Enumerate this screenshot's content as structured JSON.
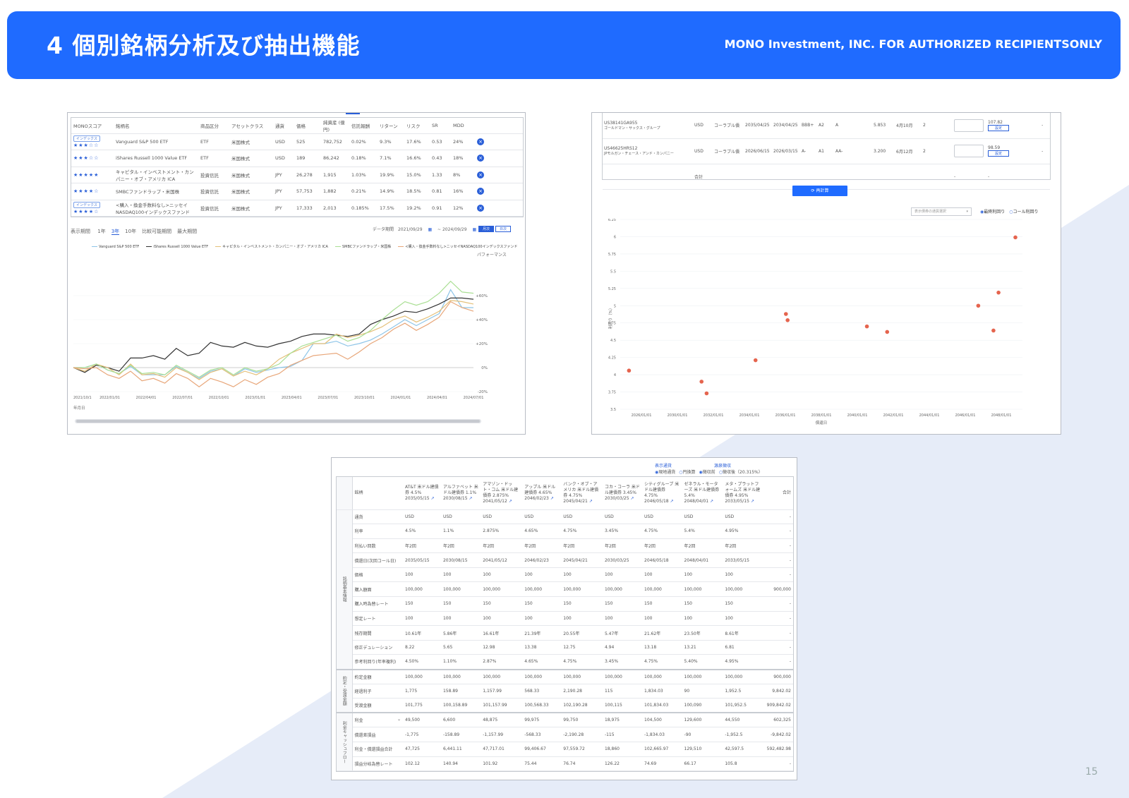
{
  "header": {
    "title": "4 個別銘柄分析及び抽出機能",
    "subtitle": "MONO Investment, INC. FOR AUTHORIZED RECIPIENTSONLY"
  },
  "page_number": "15",
  "colors": {
    "accent": "#1f6bff",
    "scatter_dot": "#e5644e",
    "background_shape": "#e6ecf8"
  },
  "fund_panel": {
    "columns": [
      "MONOスコア",
      "銘柄名",
      "商品区分",
      "アセットクラス",
      "通貨",
      "価格",
      "純資産\n(億円)",
      "信託報酬",
      "リターン",
      "リスク",
      "SR",
      "MDD"
    ],
    "rows": [
      {
        "badge": "インデックス",
        "stars": "★★★☆☆",
        "name": "Vanguard S&P 500 ETF",
        "type": "ETF",
        "asset": "米国株式",
        "currency": "USD",
        "price": "525",
        "aum": "782,752",
        "fee": "0.02%",
        "ret": "9.3%",
        "risk": "17.6%",
        "sr": "0.53",
        "mdd": "24%"
      },
      {
        "badge": "",
        "stars": "★★★☆☆",
        "name": "iShares Russell 1000 Value ETF",
        "type": "ETF",
        "asset": "米国株式",
        "currency": "USD",
        "price": "189",
        "aum": "86,242",
        "fee": "0.18%",
        "ret": "7.1%",
        "risk": "16.6%",
        "sr": "0.43",
        "mdd": "18%"
      },
      {
        "badge": "",
        "stars": "★★★★★",
        "name": "キャピタル・インベストメント・カンパニー・オブ・アメリカ ICA",
        "type": "投資信託",
        "asset": "米国株式",
        "currency": "JPY",
        "price": "26,278",
        "aum": "1,915",
        "fee": "1.03%",
        "ret": "19.9%",
        "risk": "15.0%",
        "sr": "1.33",
        "mdd": "8%"
      },
      {
        "badge": "",
        "stars": "★★★★☆",
        "name": "SMBCファンドラップ・米国株",
        "type": "投資信託",
        "asset": "米国株式",
        "currency": "JPY",
        "price": "57,753",
        "aum": "1,882",
        "fee": "0.21%",
        "ret": "14.9%",
        "risk": "18.5%",
        "sr": "0.81",
        "mdd": "16%"
      },
      {
        "badge": "インデックス",
        "stars": "★★★★☆",
        "name": "<購入・換金手数料なし>ニッセイNASDAQ100インデックスファンド",
        "type": "投資信託",
        "asset": "米国株式",
        "currency": "JPY",
        "price": "17,333",
        "aum": "2,013",
        "fee": "0.185%",
        "ret": "17.5%",
        "risk": "19.2%",
        "sr": "0.91",
        "mdd": "12%"
      }
    ],
    "period_label": "表示期間",
    "period_tabs": [
      "1年",
      "3年",
      "10年",
      "比較可能期間",
      "最大期間"
    ],
    "period_active": 1,
    "date_label": "データ期間",
    "date_from": "2021/09/29",
    "date_to": "~ 2024/09/29",
    "view_buttons": [
      "月次",
      "日次"
    ],
    "perf_label": "パフォーマンス",
    "date_axis_label": "年月日"
  },
  "perf_chart": {
    "type": "line",
    "x": [
      "2021/10/01",
      "2021/11/01",
      "2021/12/01",
      "2022/01/01",
      "2022/02/01",
      "2022/03/01",
      "2022/04/01",
      "2022/05/01",
      "2022/06/01",
      "2022/07/01",
      "2022/08/01",
      "2022/09/01",
      "2022/10/01",
      "2022/11/01",
      "2022/12/01",
      "2023/01/01",
      "2023/02/01",
      "2023/03/01",
      "2023/04/01",
      "2023/05/01",
      "2023/06/01",
      "2023/07/01",
      "2023/08/01",
      "2023/09/01",
      "2023/10/01",
      "2023/11/01",
      "2023/12/01",
      "2024/01/01",
      "2024/02/01",
      "2024/03/01",
      "2024/04/01",
      "2024/05/01",
      "2024/06/01",
      "2024/07/01",
      "2024/08/01",
      "2024/09/01"
    ],
    "x_ticks": [
      "2021/10/1",
      "2022/01/01",
      "2022/04/01",
      "2022/07/01",
      "2022/10/01",
      "2023/01/01",
      "2023/04/01",
      "2023/07/01",
      "2023/10/01",
      "2024/01/01",
      "2024/04/01",
      "2024/07/01"
    ],
    "y_ticks": [
      "+60%",
      "+40%",
      "+20%",
      "0%",
      "-20%"
    ],
    "ylim": [
      -20,
      80
    ],
    "series": [
      {
        "name": "Vanguard S&P 500 ETF",
        "color": "#8ec5e8",
        "values": [
          0,
          0,
          3,
          -2,
          -5,
          1,
          -6,
          -6,
          -6,
          1,
          -4,
          -9,
          -3,
          -1,
          -7,
          -1,
          -4,
          -2,
          0,
          1,
          6,
          20,
          20,
          22,
          18,
          20,
          23,
          28,
          34,
          40,
          35,
          40,
          45,
          65,
          50,
          50
        ]
      },
      {
        "name": "iShares Russell 1000 Value ETF",
        "color": "#333333",
        "values": [
          0,
          -4,
          2,
          0,
          -3,
          8,
          8,
          10,
          7,
          16,
          10,
          12,
          21,
          18,
          17,
          21,
          18,
          17,
          20,
          22,
          26,
          28,
          28,
          27,
          26,
          28,
          36,
          40,
          43,
          47,
          46,
          49,
          53,
          58,
          58,
          57
        ]
      },
      {
        "name": "キャピタル・インベストメント・カンパニー・オブ・アメリカ ICA",
        "color": "#e4c07a",
        "values": [
          0,
          -3,
          3,
          0,
          -6,
          3,
          -6,
          -5,
          -8,
          0,
          -4,
          -10,
          -4,
          -1,
          -7,
          -3,
          -6,
          -1,
          7,
          12,
          16,
          20,
          20,
          28,
          25,
          27,
          30,
          34,
          40,
          43,
          38,
          42,
          47,
          56,
          55,
          53
        ]
      },
      {
        "name": "SMBCファンドラップ・米国株",
        "color": "#aadf94",
        "values": [
          0,
          0,
          3,
          -2,
          -5,
          2,
          -5,
          -4,
          -6,
          2,
          -3,
          -8,
          -2,
          0,
          -6,
          0,
          -3,
          -1,
          3,
          12,
          18,
          21,
          24,
          27,
          22,
          25,
          31,
          40,
          48,
          55,
          52,
          55,
          62,
          72,
          63,
          62
        ]
      },
      {
        "name": "<購入・換金手数料なし>ニッセイNASDAQ100インデックスファンド",
        "color": "#e8a679",
        "values": [
          0,
          -1,
          0,
          -6,
          -9,
          -3,
          -11,
          -9,
          -13,
          -5,
          -9,
          -16,
          -9,
          -12,
          -16,
          -10,
          -14,
          -8,
          -5,
          2,
          6,
          10,
          11,
          12,
          7,
          13,
          20,
          25,
          32,
          37,
          31,
          36,
          42,
          55,
          50,
          47
        ]
      }
    ]
  },
  "bond_panel": {
    "rows": [
      {
        "code": "US38141GA955",
        "name": "ゴールドマン・サックス・グループ",
        "currency": "USD",
        "kind": "コーラブル債",
        "maturity": "2035/04/25",
        "call": "2034/04/25",
        "r1": "BBB+",
        "r2": "A2",
        "r3": "A",
        "yield": "5.853",
        "period": "4月10月",
        "count": "2",
        "price": "107.82",
        "btn": "設定"
      },
      {
        "code": "US46625HRS12",
        "name": "JPモルガン・チェース・アンド・カンパニー",
        "currency": "USD",
        "kind": "コーラブル債",
        "maturity": "2026/06/15",
        "call": "2026/03/15",
        "r1": "A-",
        "r2": "A1",
        "r3": "AA-",
        "yield": "3.200",
        "period": "6月12月",
        "count": "2",
        "price": "98.59",
        "btn": "設定"
      }
    ],
    "total_label": "合計",
    "total_dash_1": "-",
    "total_dash_2": "-",
    "recalc_button": "再計算",
    "select_placeholder": "表示債券の通貨選択",
    "radio_options": [
      "最終利回り",
      "コール利回り"
    ],
    "radio_selected": 0
  },
  "yield_chart": {
    "type": "scatter",
    "ylabel": "利回り（%）",
    "xlabel": "償還日",
    "y_ticks": [
      "6.25",
      "6",
      "5.75",
      "5.5",
      "5.25",
      "5",
      "4.75",
      "4.5",
      "4.25",
      "4",
      "3.75",
      "3.5"
    ],
    "ylim": [
      3.5,
      6.25
    ],
    "x_ticks": [
      "2026/01/01",
      "2030/01/01",
      "2032/01/01",
      "2034/01/01",
      "2036/01/01",
      "2038/01/01",
      "2040/01/01",
      "2042/01/01",
      "2044/01/01",
      "2046/01/01",
      "2048/01/01"
    ],
    "xlim": [
      2026.0,
      2049.0
    ],
    "points": [
      {
        "x": 2026.1,
        "y": 4.06
      },
      {
        "x": 2030.4,
        "y": 3.9
      },
      {
        "x": 2030.7,
        "y": 3.73
      },
      {
        "x": 2033.6,
        "y": 4.21
      },
      {
        "x": 2035.4,
        "y": 4.88
      },
      {
        "x": 2035.5,
        "y": 4.79
      },
      {
        "x": 2040.2,
        "y": 4.7
      },
      {
        "x": 2041.4,
        "y": 4.62
      },
      {
        "x": 2046.8,
        "y": 5.0
      },
      {
        "x": 2047.7,
        "y": 4.64
      },
      {
        "x": 2048.0,
        "y": 5.19
      },
      {
        "x": 2050.1,
        "y": 5.99
      }
    ]
  },
  "sim_panel": {
    "display_currency_label": "表示通貨",
    "currency_options": [
      "現地通貨",
      "円換算"
    ],
    "currency_selected": 0,
    "tax_label": "源泉徴収",
    "tax_options": [
      "徴収前",
      "徴収後（20.315%）"
    ],
    "tax_selected": 0,
    "corner_label": "銘柄",
    "total_header": "合計",
    "bonds": [
      "AT&T 米ドル建債券 4.5% 2035/05/15",
      "アルファベット 米ドル建債券 1.1% 2030/08/15",
      "アマゾン・ドット・コム 米ドル建債券 2.875% 2041/05/12",
      "アップル 米ドル建債券 4.65% 2046/02/23",
      "バンク・オブ・アメリカ 米ドル建債券 4.75% 2045/04/21",
      "コカ・コーラ 米ドル建債券 3.45% 2030/03/25",
      "シティグループ 米ドル建債券 4.75% 2046/05/18",
      "ゼネラル・モーターズ 米ドル建債券 5.4% 2048/04/01",
      "メタ・プラットフォームズ 米ドル建債券 4.95% 2033/05/15"
    ],
    "sections": [
      {
        "label": "銘柄基本情報",
        "rows": [
          {
            "label": "通貨",
            "values": [
              "USD",
              "USD",
              "USD",
              "USD",
              "USD",
              "USD",
              "USD",
              "USD",
              "USD"
            ],
            "total": "-"
          },
          {
            "label": "利率",
            "values": [
              "4.5%",
              "1.1%",
              "2.875%",
              "4.65%",
              "4.75%",
              "3.45%",
              "4.75%",
              "5.4%",
              "4.95%"
            ],
            "total": "-"
          },
          {
            "label": "利払い回数",
            "values": [
              "年2回",
              "年2回",
              "年2回",
              "年2回",
              "年2回",
              "年2回",
              "年2回",
              "年2回",
              "年2回"
            ],
            "total": "-"
          },
          {
            "label": "償還日(次回コール日)",
            "values": [
              "2035/05/15",
              "2030/08/15",
              "2041/05/12",
              "2046/02/23",
              "2045/04/21",
              "2030/03/25",
              "2046/05/18",
              "2048/04/01",
              "2033/05/15"
            ],
            "total": "-"
          },
          {
            "label": "価格",
            "values": [
              "100",
              "100",
              "100",
              "100",
              "100",
              "100",
              "100",
              "100",
              "100"
            ],
            "total": "-"
          },
          {
            "label": "購入額面",
            "values": [
              "100,000",
              "100,000",
              "100,000",
              "100,000",
              "100,000",
              "100,000",
              "100,000",
              "100,000",
              "100,000"
            ],
            "total": "900,000"
          },
          {
            "label": "購入時為替レート",
            "values": [
              "150",
              "150",
              "150",
              "150",
              "150",
              "150",
              "150",
              "150",
              "150"
            ],
            "total": "-"
          },
          {
            "label": "想定レート",
            "values": [
              "100",
              "100",
              "100",
              "100",
              "100",
              "100",
              "100",
              "100",
              "100"
            ],
            "total": "-"
          },
          {
            "label": "残存期間",
            "values": [
              "10.61年",
              "5.86年",
              "16.61年",
              "21.39年",
              "20.55年",
              "5.47年",
              "21.62年",
              "23.50年",
              "8.61年"
            ],
            "total": "-"
          },
          {
            "label": "修正デュレーション",
            "values": [
              "8.22",
              "5.65",
              "12.98",
              "13.38",
              "12.75",
              "4.94",
              "13.18",
              "13.21",
              "6.81"
            ],
            "total": "-"
          },
          {
            "label": "参考利回り(年率複利)",
            "values": [
              "4.50%",
              "1.10%",
              "2.87%",
              "4.65%",
              "4.75%",
              "3.45%",
              "4.75%",
              "5.40%",
              "4.95%"
            ],
            "total": "-"
          }
        ]
      },
      {
        "label": "約定・受渡金額",
        "rows": [
          {
            "label": "約定金額",
            "values": [
              "100,000",
              "100,000",
              "100,000",
              "100,000",
              "100,000",
              "100,000",
              "100,000",
              "100,000",
              "100,000"
            ],
            "total": "900,000"
          },
          {
            "label": "経過利子",
            "values": [
              "1,775",
              "158.89",
              "1,157.99",
              "568.33",
              "2,190.28",
              "115",
              "1,834.03",
              "90",
              "1,952.5"
            ],
            "total": "9,842.02"
          },
          {
            "label": "受渡金額",
            "values": [
              "101,775",
              "100,158.89",
              "101,157.99",
              "100,568.33",
              "102,190.28",
              "100,115",
              "101,834.03",
              "100,090",
              "101,952.5"
            ],
            "total": "909,842.02"
          }
        ]
      },
      {
        "label": "利金キャッシュフロー",
        "rows": [
          {
            "label": "利金",
            "values": [
              "49,500",
              "6,600",
              "48,875",
              "99,975",
              "99,750",
              "18,975",
              "104,500",
              "129,600",
              "44,550"
            ],
            "total": "602,325"
          },
          {
            "label": "償還差損益",
            "values": [
              "-1,775",
              "-158.89",
              "-1,157.99",
              "-568.33",
              "-2,190.28",
              "-115",
              "-1,834.03",
              "-90",
              "-1,952.5"
            ],
            "total": "-9,842.02"
          },
          {
            "label": "利金・償還損益合計",
            "values": [
              "47,725",
              "6,441.11",
              "47,717.01",
              "99,406.67",
              "97,559.72",
              "18,860",
              "102,665.97",
              "129,510",
              "42,597.5"
            ],
            "total": "592,482.98"
          },
          {
            "label": "損益分岐為替レート",
            "values": [
              "102.12",
              "140.94",
              "101.92",
              "75.44",
              "76.74",
              "126.22",
              "74.69",
              "66.17",
              "105.8"
            ],
            "total": "-"
          }
        ]
      }
    ]
  }
}
